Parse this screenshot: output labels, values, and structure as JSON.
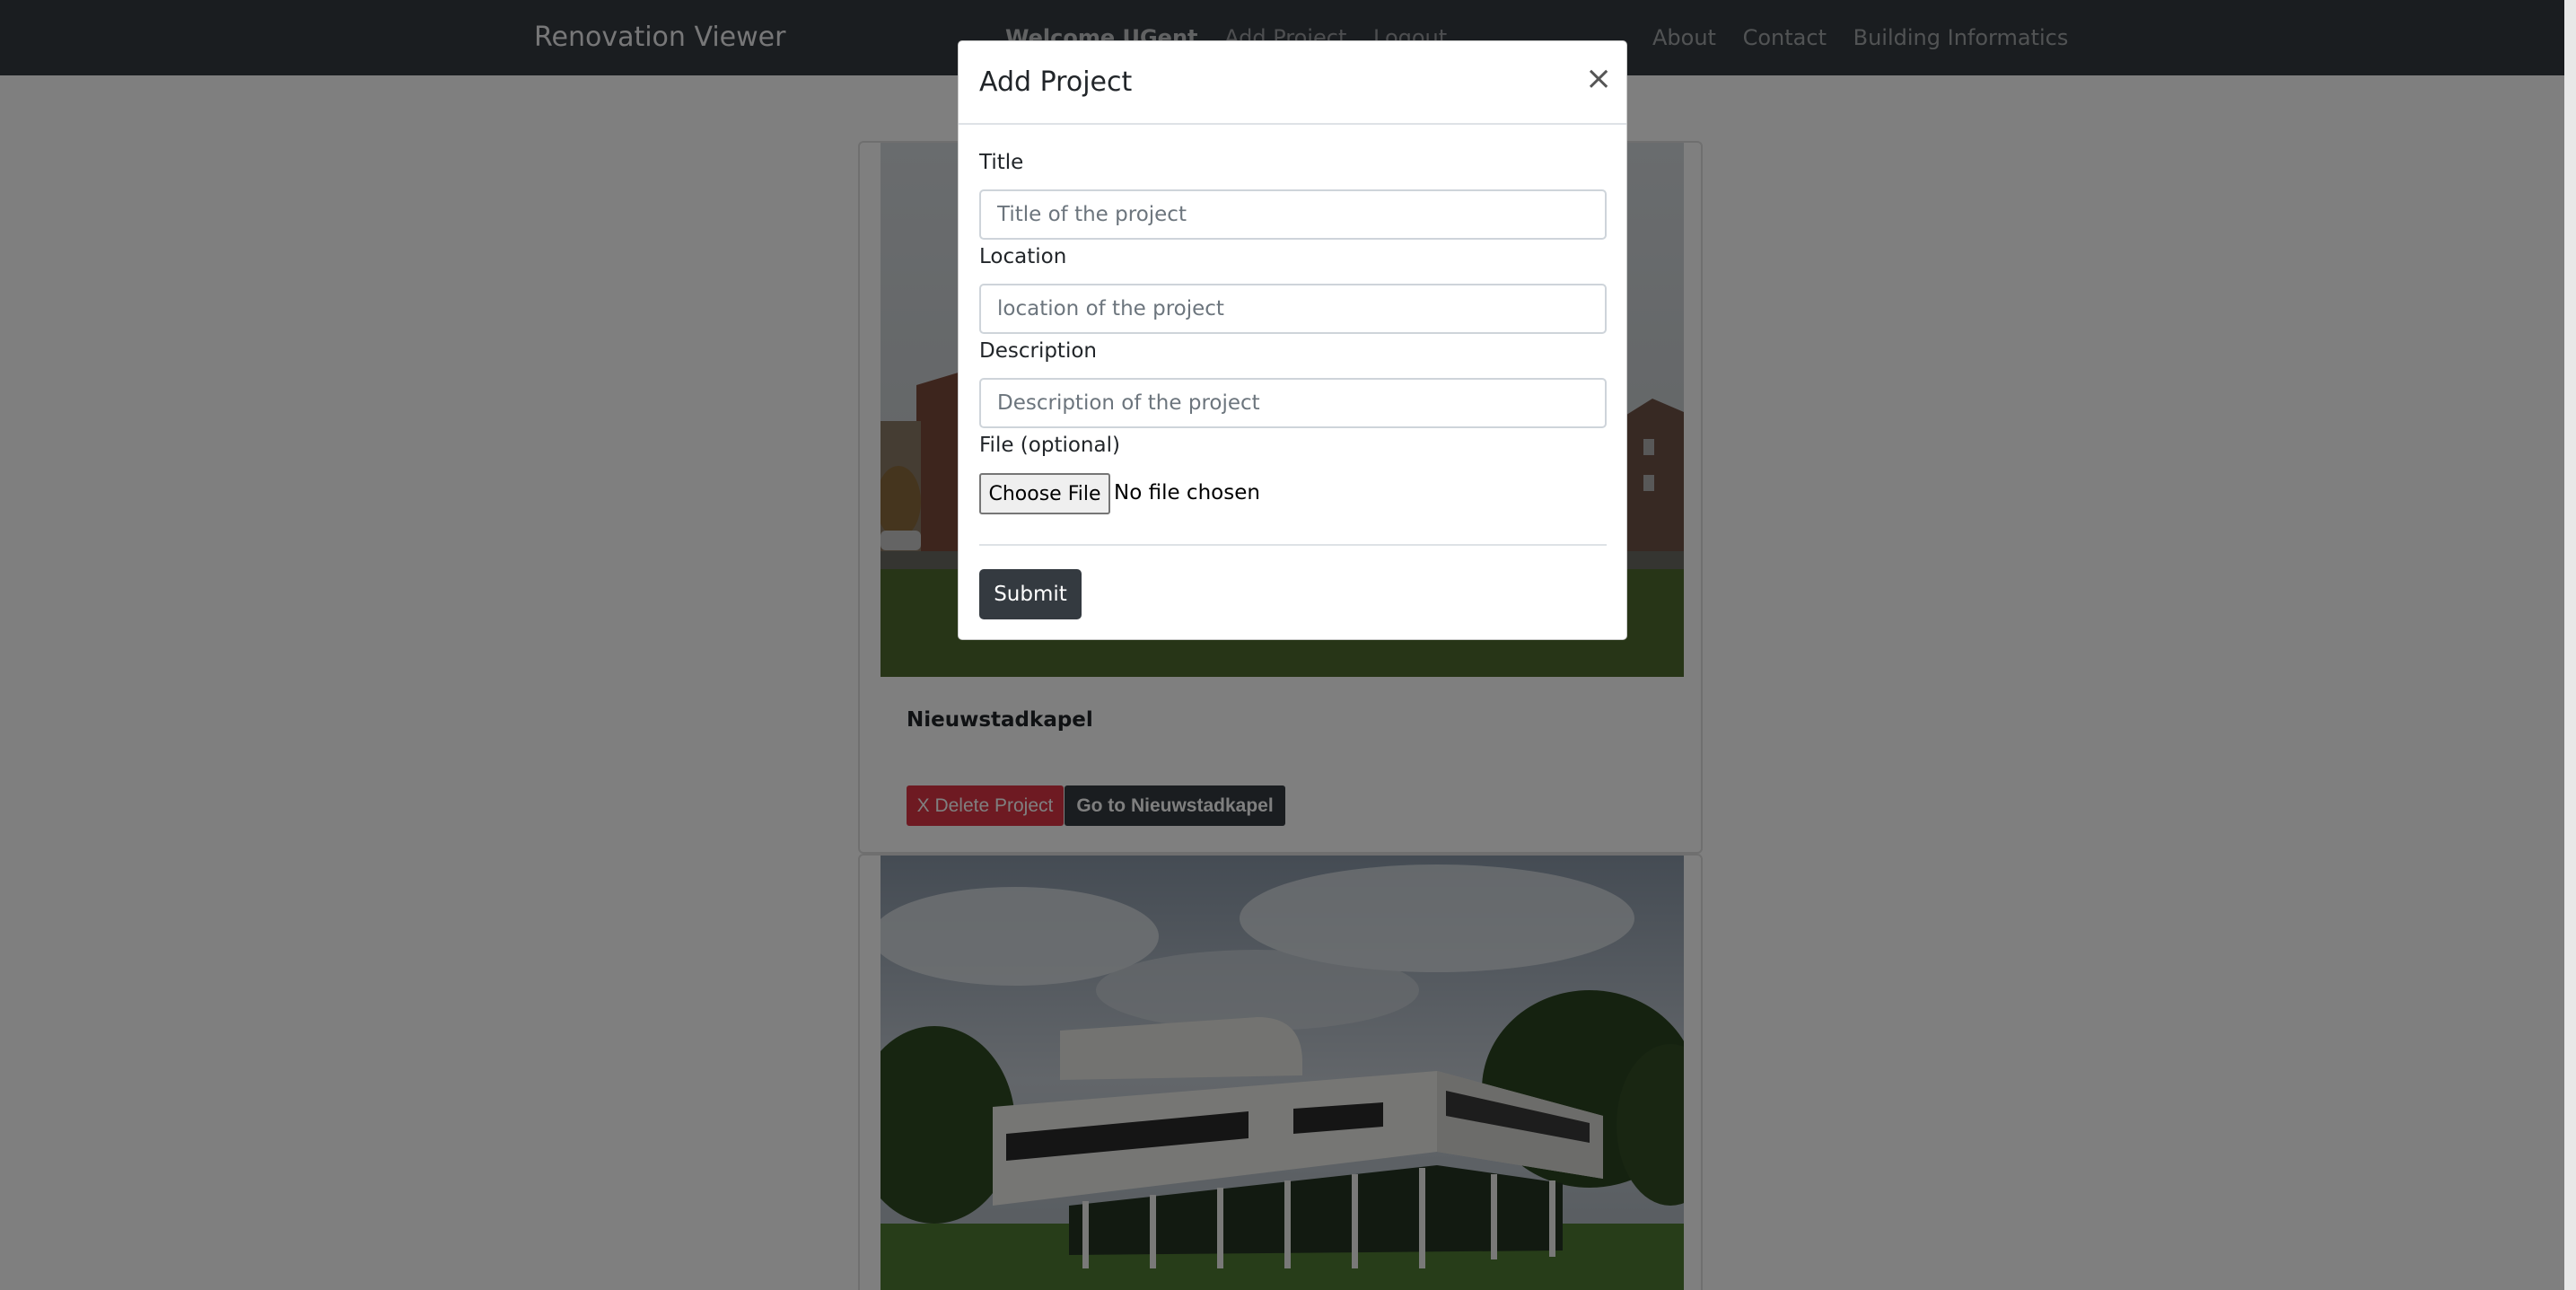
{
  "navbar": {
    "brand": "Renovation Viewer",
    "welcome": "Welcome UGent",
    "add_project": "Add Project",
    "logout": "Logout",
    "about": "About",
    "contact": "Contact",
    "building_informatics": "Building Informatics"
  },
  "projects": [
    {
      "title": "Nieuwstadkapel",
      "delete_label": "X Delete Project",
      "goto_label": "Go to Nieuwstadkapel"
    }
  ],
  "modal": {
    "title": "Add Project",
    "close_symbol": "×",
    "title_label": "Title",
    "title_placeholder": "Title of the project",
    "location_label": "Location",
    "location_placeholder": "location of the project",
    "description_label": "Description",
    "description_placeholder": "Description of the project",
    "file_label": "File (optional)",
    "file_button": "Choose File",
    "file_status": "No file chosen",
    "submit_label": "Submit"
  },
  "colors": {
    "navbar_bg": "#343a40",
    "danger": "#dc3545",
    "dark": "#343a40",
    "backdrop": "rgba(0,0,0,0.5)"
  }
}
